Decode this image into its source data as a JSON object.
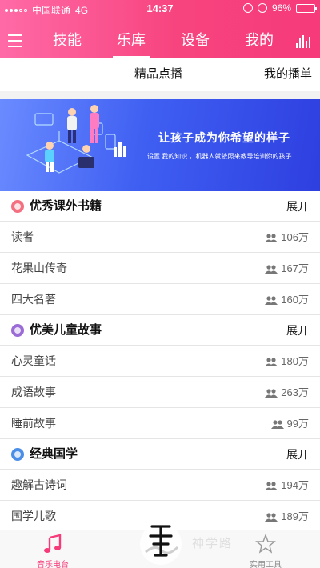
{
  "status_bar": {
    "carrier": "中国联通",
    "network": "4G",
    "time": "14:37",
    "battery": "96%",
    "battery_level": 0.96
  },
  "nav": {
    "tabs": [
      "技能",
      "乐库",
      "设备",
      "我的"
    ],
    "active_tab": "乐库"
  },
  "subtabs": [
    "精品点播",
    "我的播单"
  ],
  "banner": {
    "title": "让孩子成为你希望的样子",
    "subtitle": "设置 我的知识 ，机器人就依照来教导培训你的孩子"
  },
  "sections": [
    {
      "title": "优秀课外书籍",
      "toggle": "展开",
      "icon": "book-icon",
      "color": "#f46f80",
      "items": [
        {
          "name": "读者",
          "count": "106万"
        },
        {
          "name": "花果山传奇",
          "count": "167万"
        },
        {
          "name": "四大名著",
          "count": "160万"
        }
      ]
    },
    {
      "title": "优美儿童故事",
      "toggle": "展开",
      "icon": "story-icon",
      "color": "#9b6bd6",
      "items": [
        {
          "name": "心灵童话",
          "count": "180万"
        },
        {
          "name": "成语故事",
          "count": "263万"
        },
        {
          "name": "睡前故事",
          "count": "99万"
        }
      ]
    },
    {
      "title": "经典国学",
      "toggle": "展开",
      "icon": "classics-icon",
      "color": "#4a8ee8",
      "items": [
        {
          "name": "趣解古诗词",
          "count": "194万"
        },
        {
          "name": "国学儿歌",
          "count": "189万"
        }
      ]
    }
  ],
  "tabbar": {
    "items": [
      {
        "label": "音乐电台",
        "icon": "music-note-icon"
      },
      {
        "label": "实用工具",
        "icon": "star-icon"
      }
    ]
  },
  "watermark_text": "神学路",
  "colors": {
    "accent": "#f63a7a",
    "banner": "#3f5ff2"
  }
}
